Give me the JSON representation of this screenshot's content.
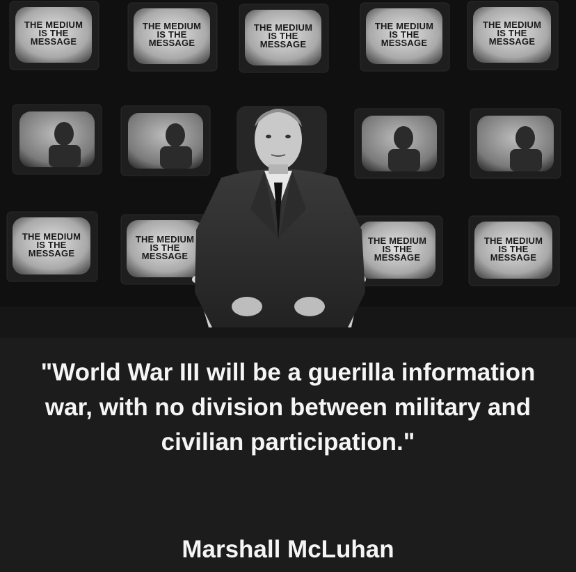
{
  "photo": {
    "tv_slogan": [
      "THE MEDIUM",
      "IS THE",
      "MESSAGE"
    ]
  },
  "quote": "\"World War III will be a guerilla information war, with no division between military and civilian participation.\"",
  "author": "Marshall McLuhan",
  "colors": {
    "caption_background": "#1c1c1c",
    "caption_text": "#f5f5f5"
  }
}
